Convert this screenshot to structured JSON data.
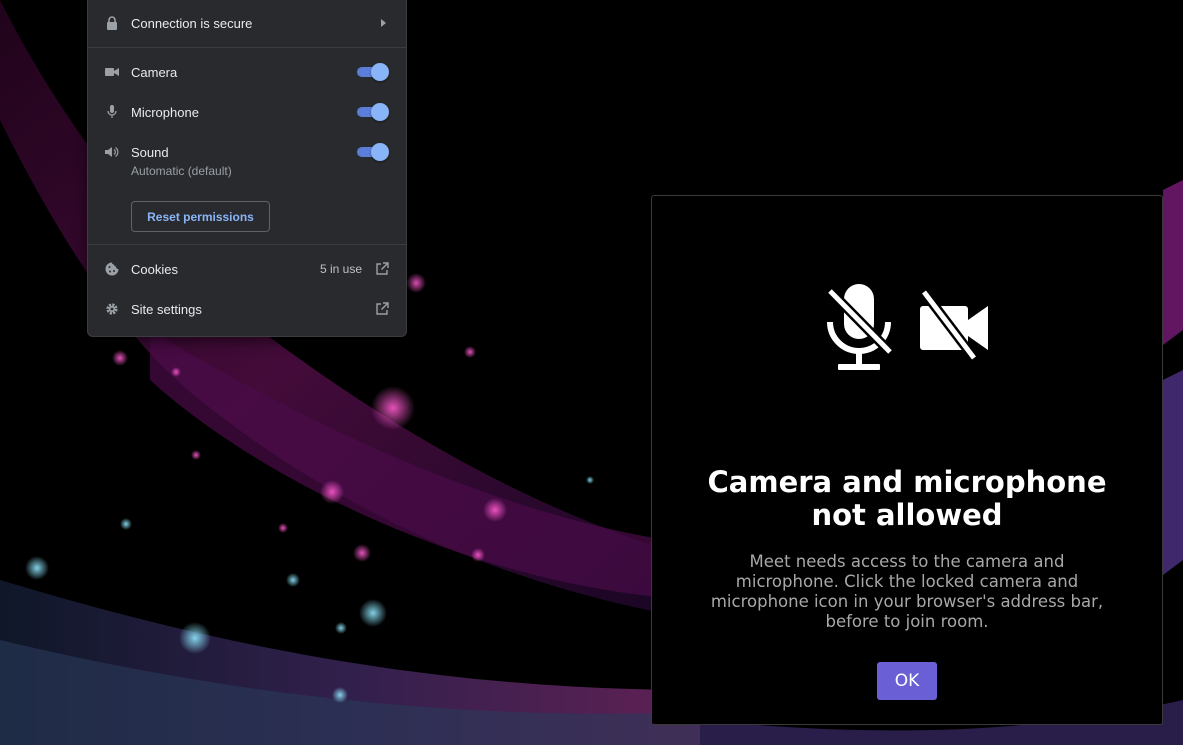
{
  "site_info_popup": {
    "connection_label": "Connection is secure",
    "permissions": [
      {
        "label": "Camera",
        "icon": "camera-icon",
        "enabled": true
      },
      {
        "label": "Microphone",
        "icon": "microphone-icon",
        "enabled": true
      },
      {
        "label": "Sound",
        "icon": "speaker-icon",
        "enabled": true,
        "sublabel": "Automatic (default)"
      }
    ],
    "reset_button_label": "Reset permissions",
    "cookies": {
      "label": "Cookies",
      "count_text": "5 in use"
    },
    "site_settings_label": "Site settings"
  },
  "meet_dialog": {
    "icons": [
      "microphone-off-icon",
      "camera-off-icon"
    ],
    "title_line1": "Camera and microphone",
    "title_line2": "not allowed",
    "body_line1": "Meet needs access to the camera and",
    "body_line2": "microphone. Click the locked camera and",
    "body_line3": "microphone icon in your browser's address bar,",
    "body_line4": "before to join room.",
    "ok_label": "OK"
  },
  "colors": {
    "popup_bg": "#292a2d",
    "toggle_on": "#8ab4f8",
    "link_blue": "#8ab4f8",
    "dialog_bg": "#000000",
    "ok_button": "#6b5fd6"
  }
}
